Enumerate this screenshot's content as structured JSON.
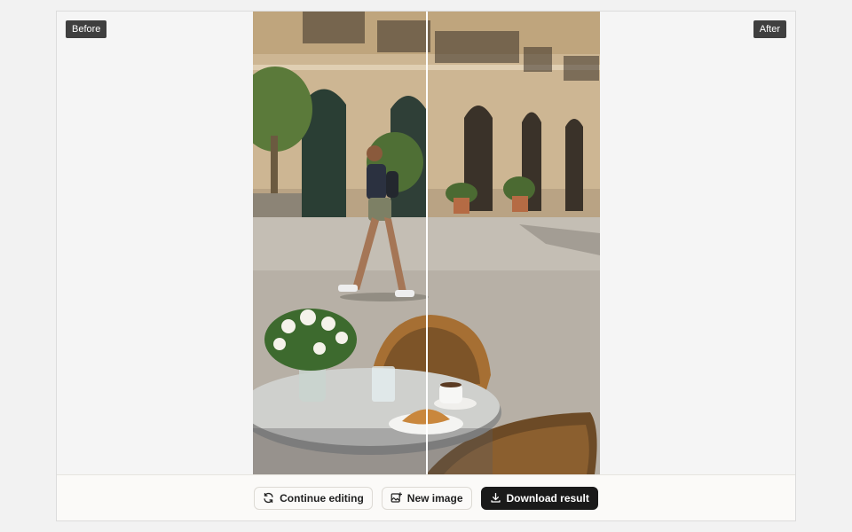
{
  "compare": {
    "before_label": "Before",
    "after_label": "After",
    "divider_position": 0.5
  },
  "actions": {
    "continue_label": "Continue editing",
    "continue_icon": "refresh-icon",
    "new_image_label": "New image",
    "new_image_icon": "image-add-icon",
    "download_label": "Download result",
    "download_icon": "download-icon"
  },
  "colors": {
    "primary_button": "#1a1a1a",
    "badge": "#3f3f3f"
  }
}
